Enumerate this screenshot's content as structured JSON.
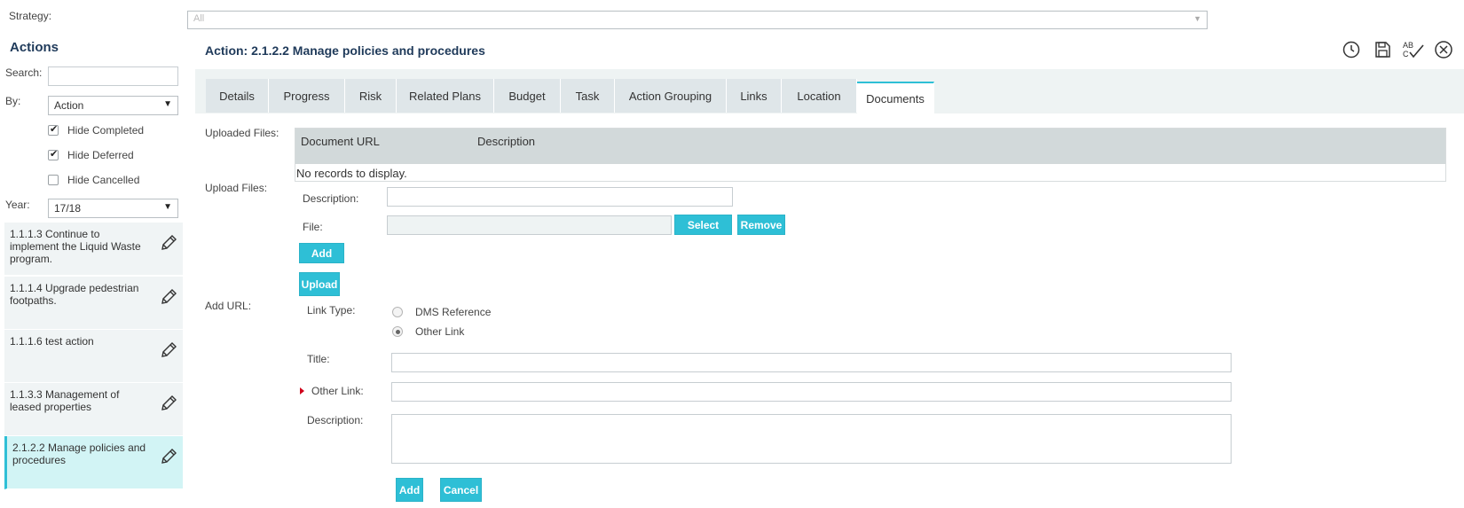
{
  "strategy": {
    "label": "Strategy:",
    "value": "All"
  },
  "sidebar": {
    "title": "Actions",
    "search_label": "Search:",
    "search_value": "",
    "by_label": "By:",
    "by_value": "Action",
    "hide_completed": {
      "label": "Hide Completed",
      "checked": true
    },
    "hide_deferred": {
      "label": "Hide Deferred",
      "checked": true
    },
    "hide_cancelled": {
      "label": "Hide Cancelled",
      "checked": false
    },
    "year_label": "Year:",
    "year_value": "17/18",
    "items": [
      {
        "label": "1.1.1.3 Continue to implement the Liquid Waste program."
      },
      {
        "label": "1.1.1.4 Upgrade pedestrian footpaths."
      },
      {
        "label": "1.1.1.6 test action"
      },
      {
        "label": "1.1.3.3 Management of leased properties"
      },
      {
        "label": "2.1.2.2 Manage policies and procedures",
        "selected": true
      }
    ]
  },
  "header": {
    "title": "Action: 2.1.2.2 Manage policies and procedures",
    "icons": [
      "history-icon",
      "save-icon",
      "spellcheck-icon",
      "close-icon"
    ]
  },
  "tabs": [
    {
      "label": "Details"
    },
    {
      "label": "Progress"
    },
    {
      "label": "Risk"
    },
    {
      "label": "Related Plans"
    },
    {
      "label": "Budget"
    },
    {
      "label": "Task"
    },
    {
      "label": "Action Grouping"
    },
    {
      "label": "Links"
    },
    {
      "label": "Location"
    },
    {
      "label": "Documents",
      "active": true
    }
  ],
  "documents": {
    "uploaded_label": "Uploaded Files:",
    "columns": [
      "Document URL",
      "Description"
    ],
    "empty_text": "No records to display.",
    "upload_label": "Upload Files:",
    "description_label": "Description:",
    "file_label": "File:",
    "select_button": "Select",
    "remove_button": "Remove",
    "add_button": "Add",
    "upload_button": "Upload",
    "add_url_label": "Add URL:",
    "link_type_label": "Link Type:",
    "link_types": [
      {
        "label": "DMS Reference",
        "selected": false
      },
      {
        "label": "Other Link",
        "selected": true
      }
    ],
    "title_label": "Title:",
    "other_link_label": "Other Link:",
    "url_description_label": "Description:",
    "url_add_button": "Add",
    "cancel_button": "Cancel"
  },
  "colors": {
    "accent": "#2ebfd6",
    "tab_bg": "#dfe6e9",
    "grid_header": "#d2d9da"
  }
}
